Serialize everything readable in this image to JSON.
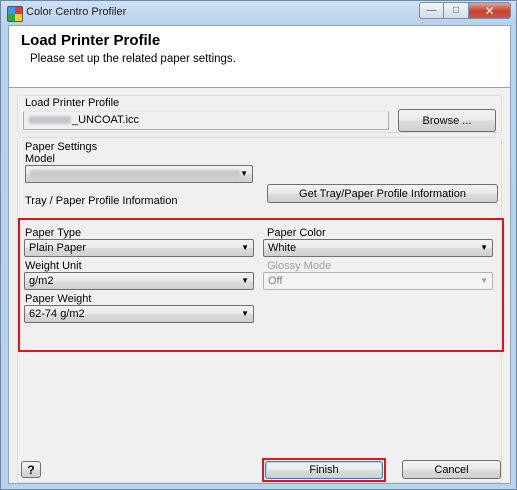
{
  "window": {
    "title": "Color Centro Profiler",
    "caption_buttons": [
      "minimize-icon",
      "maximize-icon",
      "close-icon"
    ]
  },
  "header": {
    "title": "Load Printer Profile",
    "subtitle": "Please set up the related paper settings."
  },
  "load_profile": {
    "label": "Load Printer Profile",
    "file_suffix": "_UNCOAT.icc",
    "browse_label": "Browse ..."
  },
  "paper_settings": {
    "label": "Paper Settings",
    "model_label": "Model",
    "tray_info_label": "Tray / Paper Profile Information",
    "get_info_button": "Get Tray/Paper Profile Information"
  },
  "paper": {
    "type_label": "Paper Type",
    "type_value": "Plain Paper",
    "color_label": "Paper Color",
    "color_value": "White",
    "weight_unit_label": "Weight Unit",
    "weight_unit_value": "g/m2",
    "glossy_label": "Glossy Mode",
    "glossy_value": "Off",
    "weight_label": "Paper Weight",
    "weight_value": "62-74 g/m2"
  },
  "footer": {
    "help_label": "?",
    "finish_label": "Finish",
    "cancel_label": "Cancel"
  },
  "colors": {
    "highlight": "#e0151b",
    "title_bar": "#b9d1ea"
  }
}
